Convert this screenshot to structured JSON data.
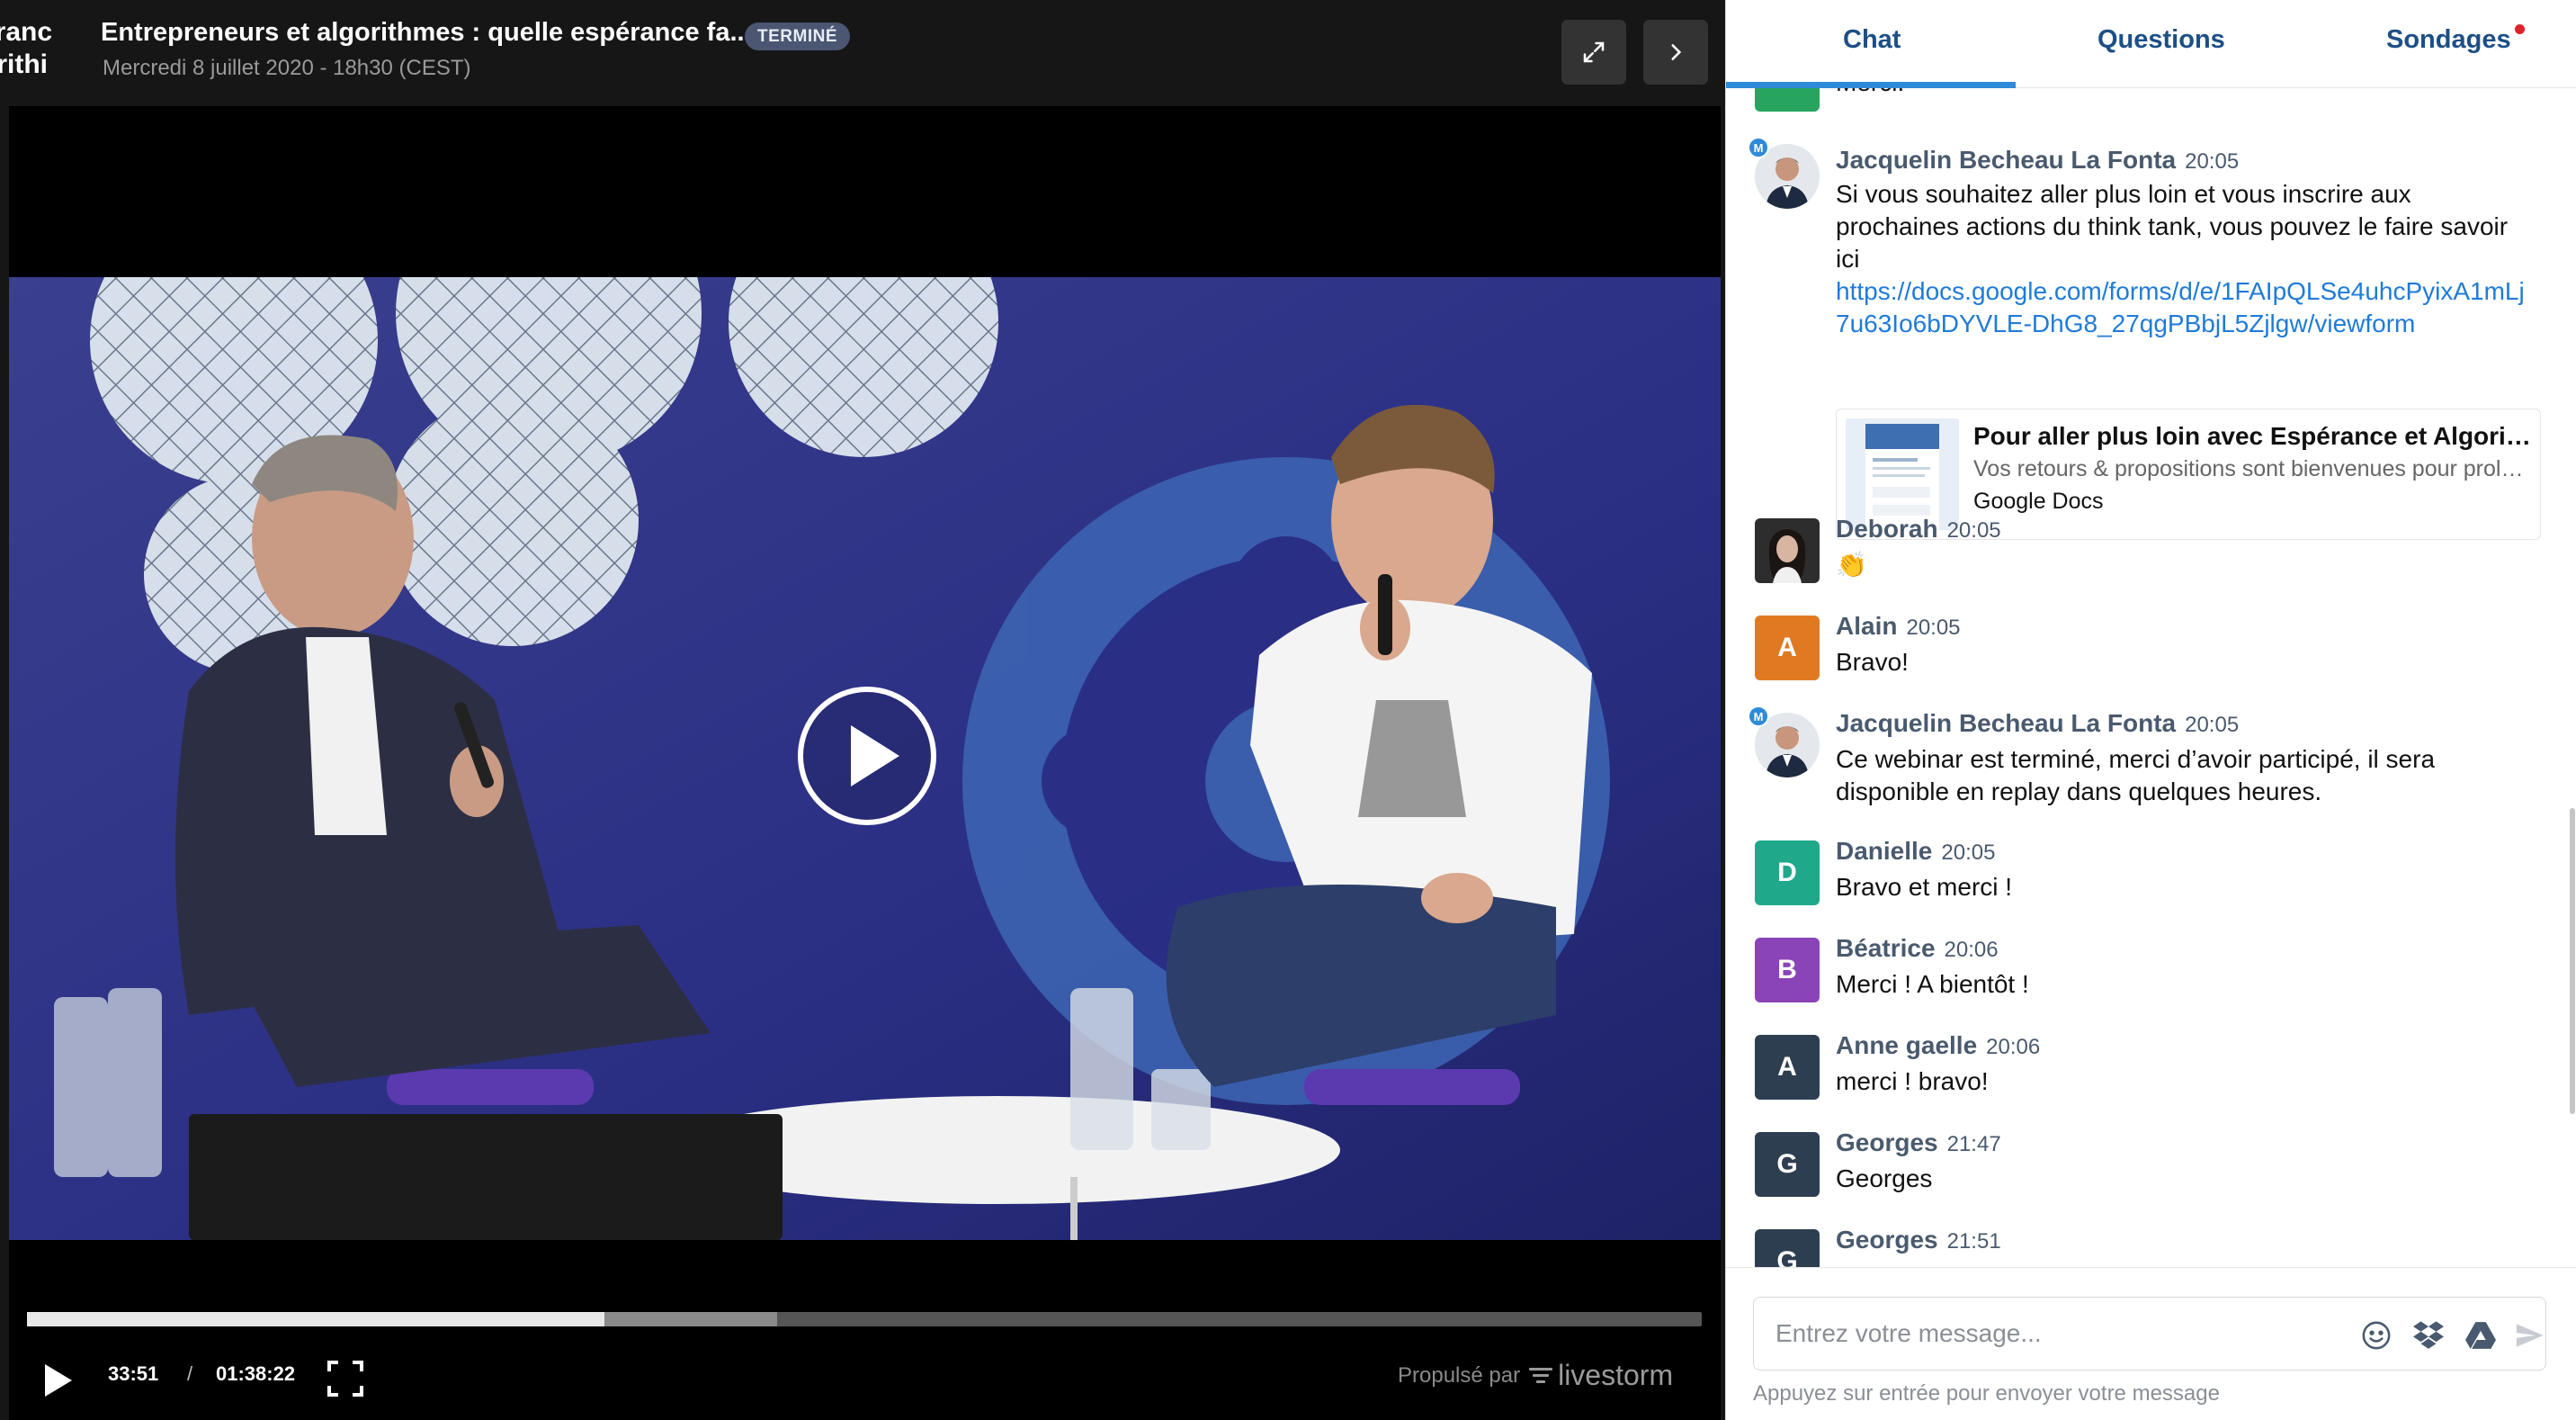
{
  "header": {
    "logo_lines": [
      "éranc",
      "orithi"
    ],
    "title": "Entrepreneurs et algorithmes : quelle espérance fa...",
    "status_badge": "TERMINÉ",
    "date": "Mercredi 8 juillet 2020 - 18h30 (CEST)",
    "icons": {
      "expand": "expand-icon",
      "next": "chevron-right-icon"
    }
  },
  "player": {
    "current_time": "33:51",
    "separator": "/",
    "total_time": "01:38:22",
    "progress_played": 0.345,
    "progress_buffered": 0.448,
    "powered_by_label": "Propulsé par",
    "brand": "livestorm",
    "icons": {
      "play": "play-icon",
      "fullscreen": "fullscreen-icon",
      "big_play": "play-circle-icon"
    }
  },
  "tabs": {
    "chat": "Chat",
    "questions": "Questions",
    "polls": "Sondages",
    "active": "chat",
    "polls_notification": true
  },
  "messages": [
    {
      "partial": true,
      "avatar_letter": "",
      "avatar_color": "#27a55f",
      "body": "Merci."
    },
    {
      "name": "Jacquelin Becheau La Fonta",
      "time": "20:05",
      "moderator_badge": "M",
      "body": "Si vous souhaitez aller plus loin et vous inscrire aux prochaines actions du think tank, vous pouvez le faire savoir ici",
      "link": "https://docs.google.com/forms/d/e/1FAIpQLSe4uhcPyixA1mLj7u63Io6bDYVLE-DhG8_27qgPBbjL5Zjlgw/viewform",
      "preview": {
        "title": "Pour aller plus loin avec Espérance et Algorithmes",
        "description": "Vos retours & propositions sont bienvenues pour prolonger la réflexion",
        "source": "Google Docs"
      }
    },
    {
      "name": "Deborah",
      "time": "20:05",
      "body": "👏",
      "avatar_photo": true
    },
    {
      "name": "Alain",
      "time": "20:05",
      "avatar_letter": "A",
      "avatar_color": "#e07a22",
      "body": "Bravo!"
    },
    {
      "name": "Jacquelin Becheau La Fonta",
      "time": "20:05",
      "moderator_badge": "M",
      "body": "Ce webinar est terminé, merci d’avoir participé, il sera disponible en replay dans quelques heures."
    },
    {
      "name": "Danielle",
      "time": "20:05",
      "avatar_letter": "D",
      "avatar_color": "#1fa88a",
      "body": "Bravo et merci !"
    },
    {
      "name": "Béatrice",
      "time": "20:06",
      "avatar_letter": "B",
      "avatar_color": "#8a44b8",
      "body": "Merci ! A bientôt !"
    },
    {
      "name": "Anne gaelle",
      "time": "20:06",
      "avatar_letter": "A",
      "avatar_color": "#2d3e50",
      "body": "merci ! bravo!"
    },
    {
      "name": "Georges",
      "time": "21:47",
      "avatar_letter": "G",
      "avatar_color": "#2d3e50",
      "body": "Georges"
    },
    {
      "name": "Georges",
      "time": "21:51",
      "avatar_letter": "G",
      "avatar_color": "#2d3e50",
      "body": ""
    }
  ],
  "composer": {
    "placeholder": "Entrez votre message...",
    "hint": "Appuyez sur entrée pour envoyer votre message",
    "icons": [
      "emoji-icon",
      "dropbox-icon",
      "google-drive-icon",
      "send-icon"
    ]
  },
  "colors": {
    "accent": "#2f8ad8",
    "tab_text": "#1d4f86",
    "name_text": "#4a5a6e",
    "link": "#1f7bd8",
    "notification": "#e0202a"
  }
}
